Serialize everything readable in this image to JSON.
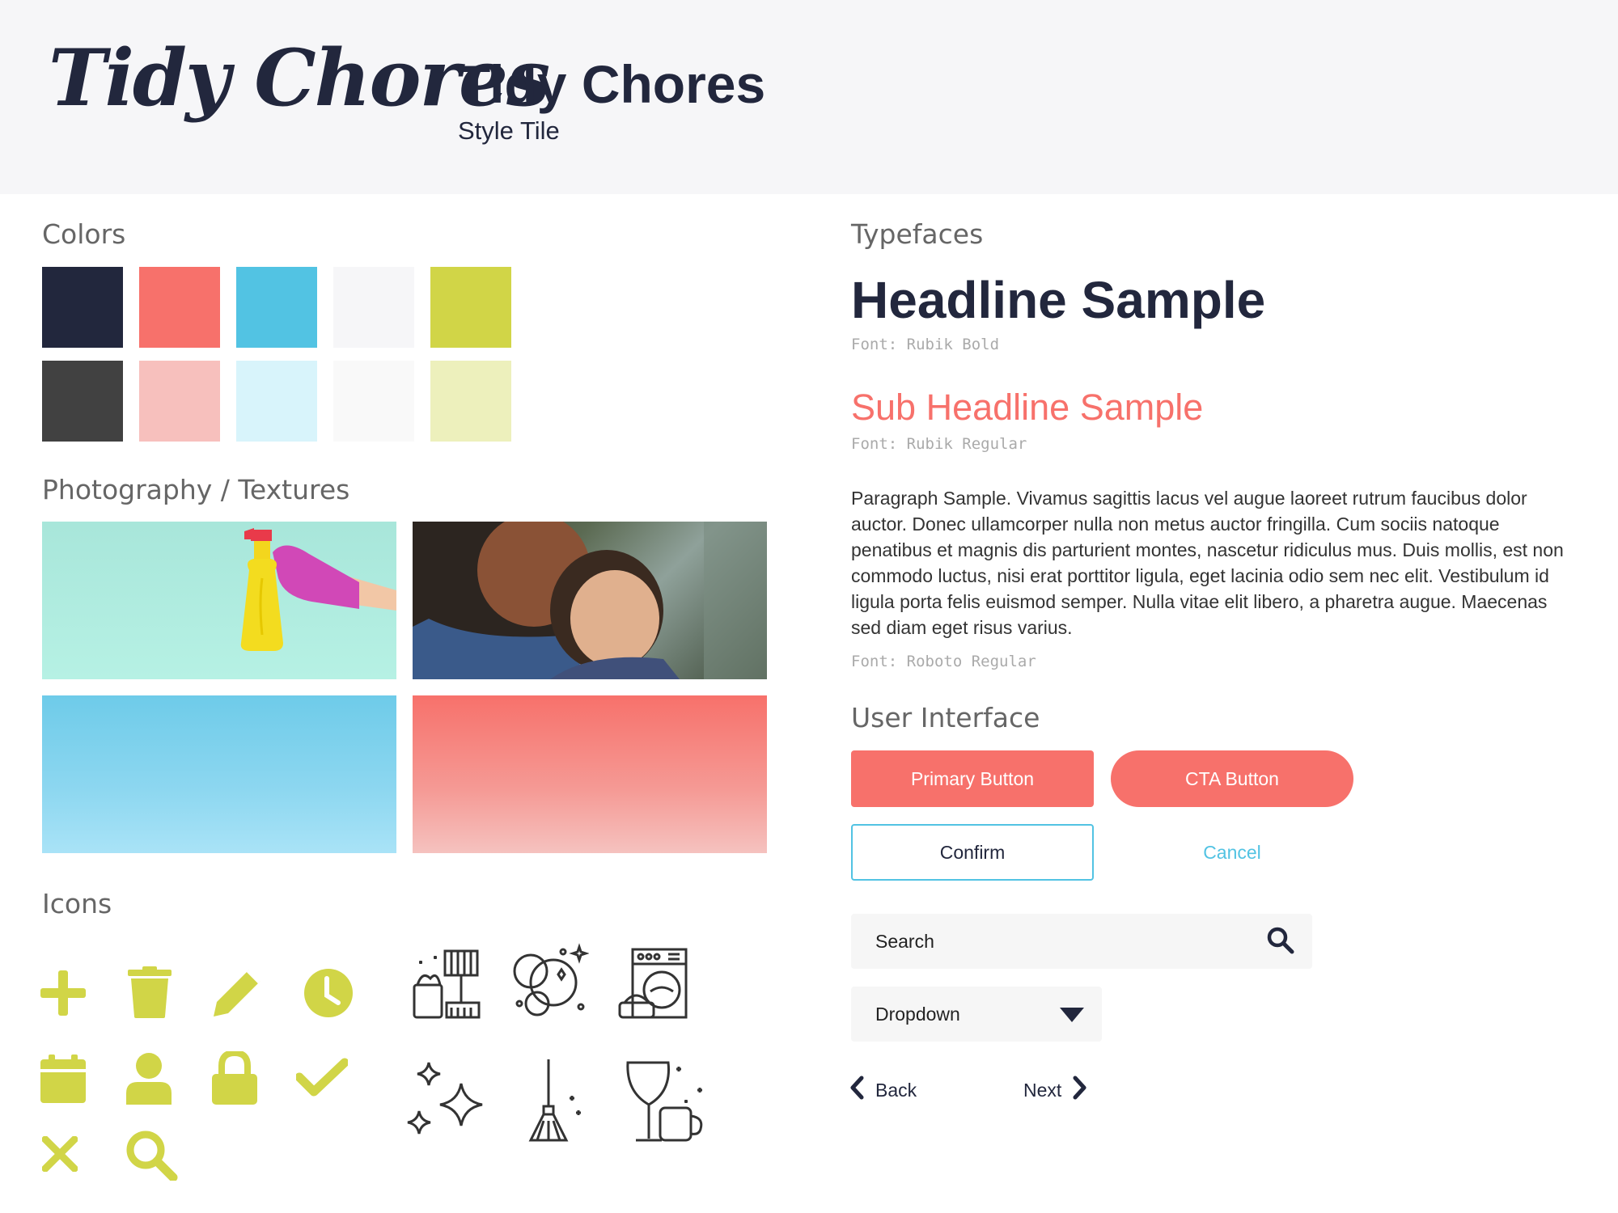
{
  "header": {
    "logo_text": "Tidy Chores",
    "title": "Tidy Chores",
    "subtitle": "Style Tile"
  },
  "colors": {
    "title": "Colors",
    "row1": [
      "#22273d",
      "#f7716b",
      "#52c3e3",
      "#f6f6f8",
      "#d1d547"
    ],
    "row2": [
      "#414141",
      "#f7c0bd",
      "#d8f4fb",
      "#f9f9f9",
      "#edf0bc"
    ]
  },
  "photography": {
    "title": "Photography / Textures"
  },
  "icons": {
    "title": "Icons",
    "accent": "#d1d547",
    "outline_color": "#333333"
  },
  "typefaces": {
    "title": "Typefaces",
    "headline": "Headline Sample",
    "headline_font": "Font: Rubik Bold",
    "subheadline": "Sub Headline Sample",
    "subheadline_font": "Font: Rubik Regular",
    "paragraph": "Paragraph Sample. Vivamus sagittis lacus vel augue laoreet rutrum faucibus dolor auctor. Donec ullamcorper nulla non metus auctor fringilla. Cum sociis natoque penatibus et magnis dis parturient montes, nascetur ridiculus mus. Duis mollis, est non commodo luctus, nisi erat porttitor ligula, eget lacinia odio sem nec elit. Vestibulum id ligula porta felis euismod semper. Nulla vitae elit libero, a pharetra augue. Maecenas sed diam eget risus varius.",
    "paragraph_font": "Font: Roboto Regular"
  },
  "ui": {
    "title": "User Interface",
    "primary_button": "Primary Button",
    "cta_button": "CTA Button",
    "confirm_button": "Confirm",
    "cancel_button": "Cancel",
    "search_placeholder": "Search",
    "dropdown_value": "Dropdown",
    "back": "Back",
    "next": "Next"
  }
}
